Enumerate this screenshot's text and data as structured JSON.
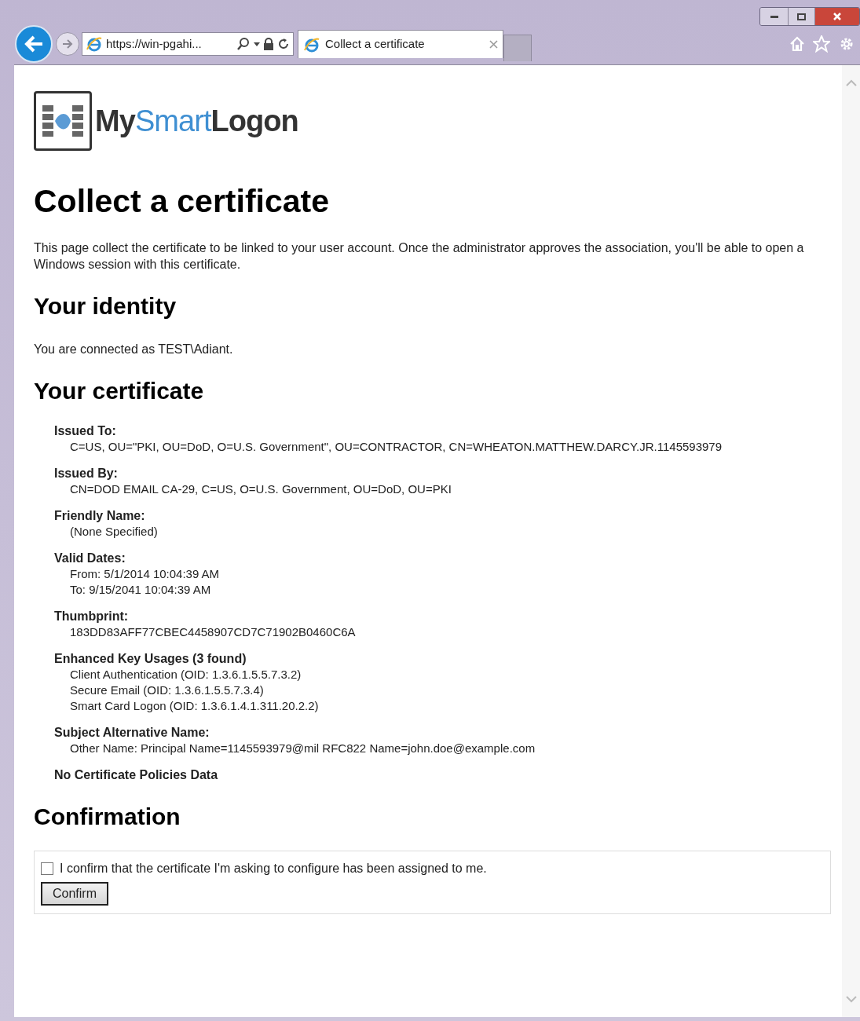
{
  "browser": {
    "address": "https://win-pgahi...",
    "tabs": [
      {
        "title": "Collect a certificate",
        "selected": true
      }
    ]
  },
  "logo": {
    "parts": [
      {
        "text": "My",
        "accent": false
      },
      {
        "text": "Smart",
        "accent": true
      },
      {
        "text": "Logon",
        "accent": false
      }
    ]
  },
  "title": "Collect a certificate",
  "intro": "This page collect the certificate to be linked to your user account. Once the administrator approves the association, you'll be able to open a Windows session with this certificate.",
  "identity": {
    "heading": "Your identity",
    "text": "You are connected as TEST\\Adiant."
  },
  "certificate": {
    "heading": "Your certificate",
    "fields": [
      {
        "label": "Issued To:",
        "values": [
          "C=US, OU=\"PKI, OU=DoD, O=U.S. Government\", OU=CONTRACTOR, CN=WHEATON.MATTHEW.DARCY.JR.1145593979"
        ]
      },
      {
        "label": "Issued By:",
        "values": [
          "CN=DOD EMAIL CA-29, C=US, O=U.S. Government, OU=DoD, OU=PKI"
        ]
      },
      {
        "label": "Friendly Name:",
        "values": [
          "(None Specified)"
        ]
      },
      {
        "label": "Valid Dates:",
        "values": [
          "From: 5/1/2014 10:04:39 AM",
          "To: 9/15/2041 10:04:39 AM"
        ]
      },
      {
        "label": "Thumbprint:",
        "values": [
          "183DD83AFF77CBEC4458907CD7C71902B0460C6A"
        ]
      },
      {
        "label": "Enhanced Key Usages (3 found)",
        "values": [
          "Client Authentication (OID: 1.3.6.1.5.5.7.3.2)",
          "Secure Email (OID: 1.3.6.1.5.5.7.3.4)",
          "Smart Card Logon (OID: 1.3.6.1.4.1.311.20.2.2)"
        ]
      },
      {
        "label": "Subject Alternative Name:",
        "values": [
          "Other Name: Principal Name=1145593979@mil RFC822 Name=john.doe@example.com"
        ]
      },
      {
        "label": "No Certificate Policies Data"
      }
    ]
  },
  "confirmation": {
    "heading": "Confirmation",
    "checkbox": {
      "label": "I confirm that the certificate I'm asking to configure has been assigned to me.",
      "checked": false
    },
    "button": "Confirm"
  }
}
